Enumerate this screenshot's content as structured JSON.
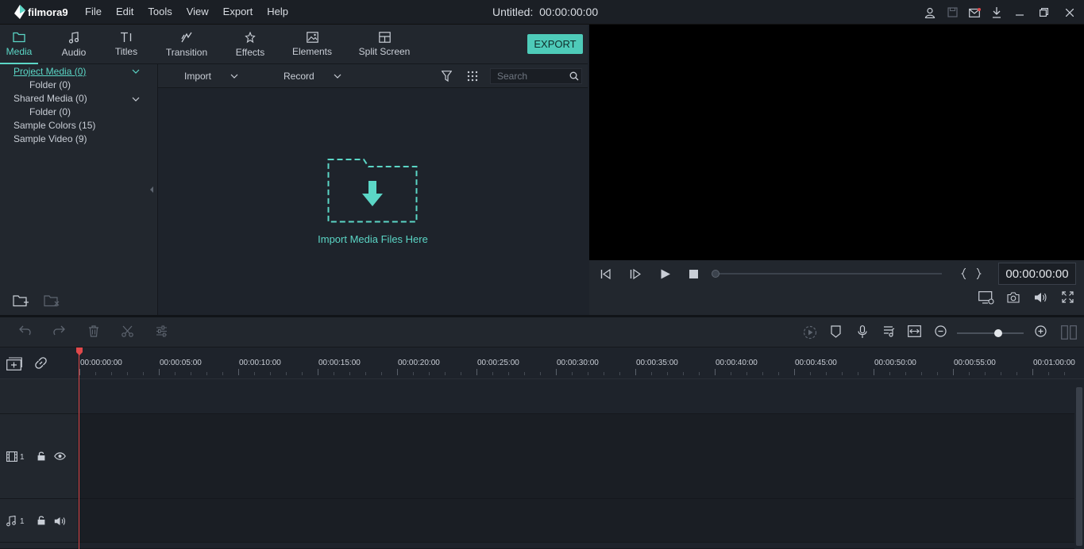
{
  "app": {
    "name": "filmora9",
    "window_title": "Untitled:",
    "timecode": "00:00:00:00"
  },
  "menu": [
    "File",
    "Edit",
    "Tools",
    "View",
    "Export",
    "Help"
  ],
  "tabs": [
    {
      "label": "Media",
      "icon": "folder-icon"
    },
    {
      "label": "Audio",
      "icon": "music-note-icon"
    },
    {
      "label": "Titles",
      "icon": "text-icon"
    },
    {
      "label": "Transition",
      "icon": "transition-icon"
    },
    {
      "label": "Effects",
      "icon": "effects-icon"
    },
    {
      "label": "Elements",
      "icon": "image-icon"
    },
    {
      "label": "Split Screen",
      "icon": "split-screen-icon"
    }
  ],
  "export_label": "EXPORT",
  "tree": [
    {
      "label": "Project Media (0)",
      "selected": true
    },
    {
      "label": "Folder (0)"
    },
    {
      "label": "Shared Media (0)"
    },
    {
      "label": "Folder (0)"
    },
    {
      "label": "Sample Colors (15)"
    },
    {
      "label": "Sample Video (9)"
    }
  ],
  "media_bar": {
    "import": "Import",
    "record": "Record",
    "search_placeholder": "Search"
  },
  "import_hint": "Import Media Files Here",
  "preview_timecode": "00:00:00:00",
  "ruler": [
    "00:00:00:00",
    "00:00:05:00",
    "00:00:10:00",
    "00:00:15:00",
    "00:00:20:00",
    "00:00:25:00",
    "00:00:30:00",
    "00:00:35:00",
    "00:00:40:00",
    "00:00:45:00",
    "00:00:50:00",
    "00:00:55:00",
    "00:01:00:00"
  ],
  "tracks": {
    "video_num": "1",
    "audio_num": "1"
  },
  "colors": {
    "accent": "#5bd6c6",
    "playhead": "#e0484a",
    "export_bg": "#4ecbb9"
  }
}
